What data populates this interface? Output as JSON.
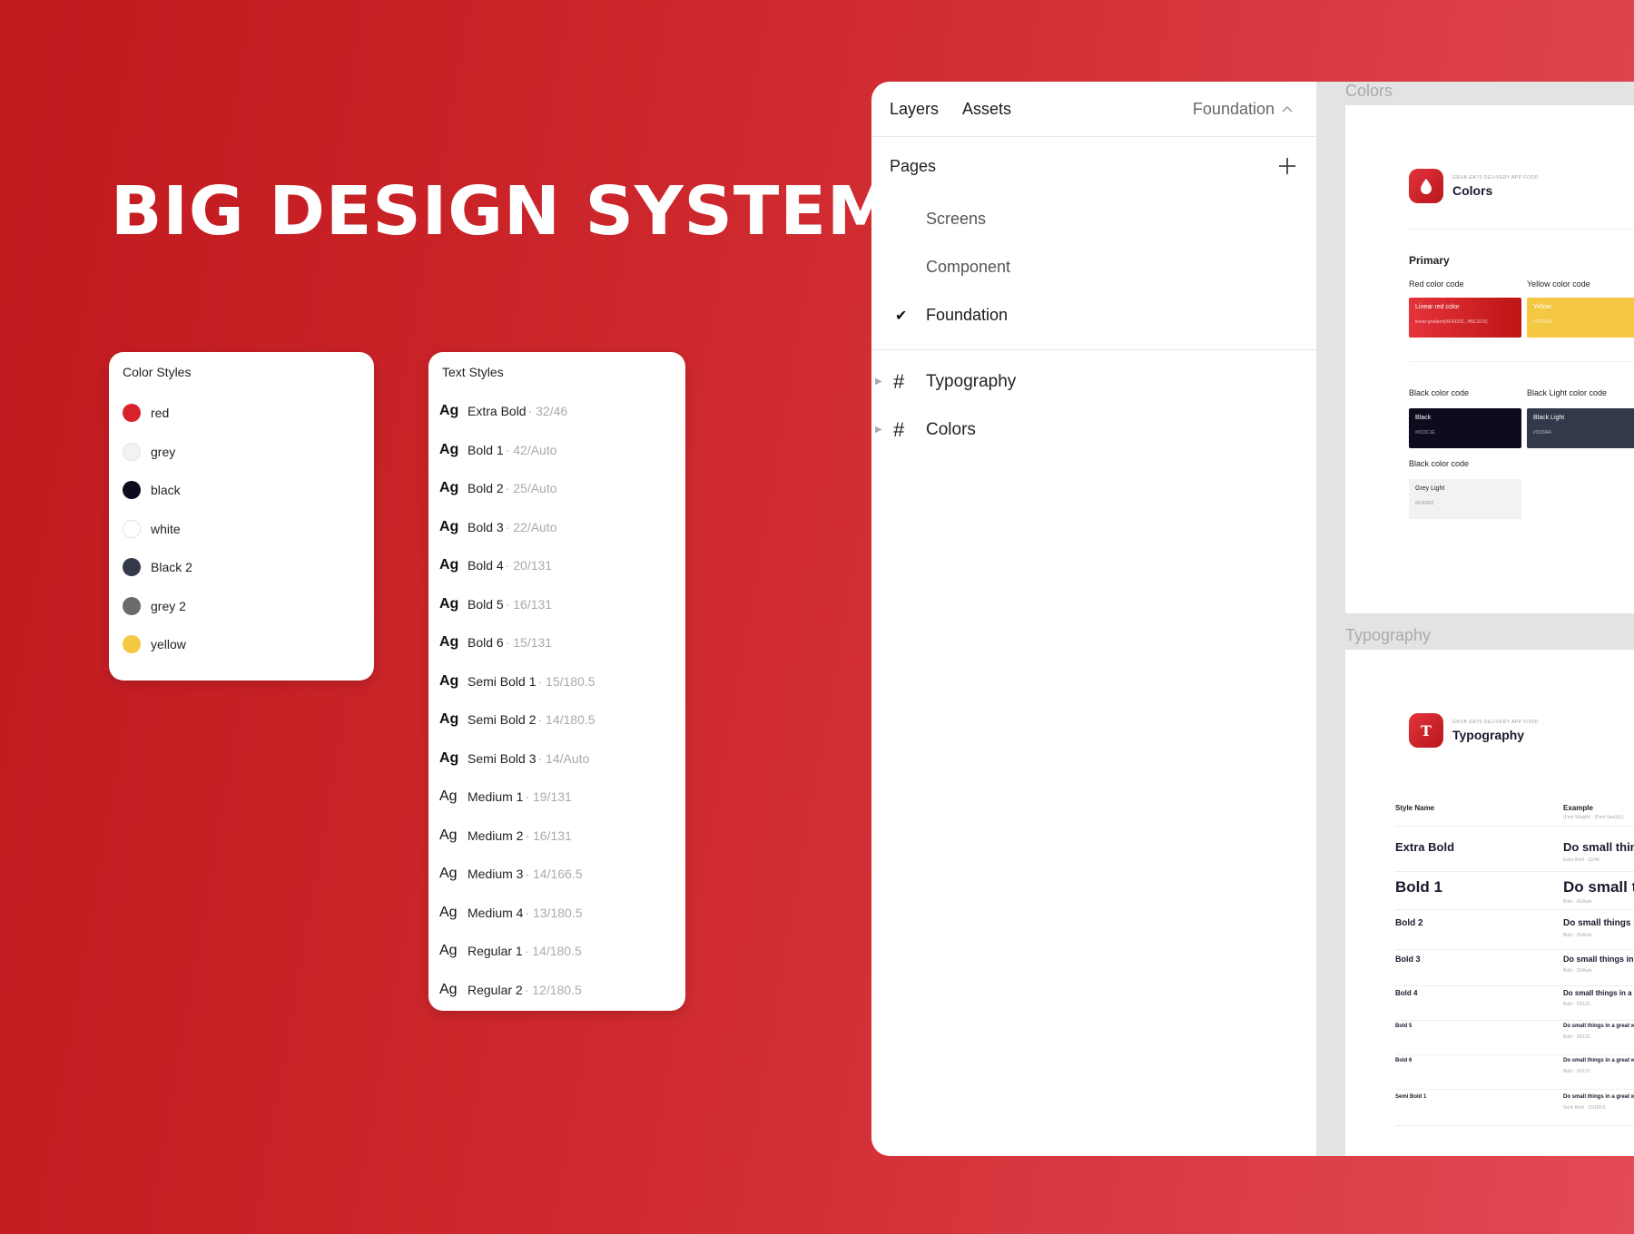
{
  "hero_title": "BIG DESIGN SYSTEM",
  "color_styles": {
    "title": "Color Styles",
    "items": [
      {
        "name": "red",
        "color": "#d8222b"
      },
      {
        "name": "grey",
        "color": "#f2f2f2"
      },
      {
        "name": "black",
        "color": "#0c0c1e"
      },
      {
        "name": "white",
        "color": "#ffffff"
      },
      {
        "name": "Black 2",
        "color": "#33394a"
      },
      {
        "name": "grey 2",
        "color": "#6b6b6b"
      },
      {
        "name": "yellow",
        "color": "#f4c842"
      }
    ]
  },
  "text_styles": {
    "title": "Text Styles",
    "glyph": "Ag",
    "items": [
      {
        "name": "Extra Bold",
        "spec": "· 32/46",
        "weight": 800
      },
      {
        "name": "Bold 1",
        "spec": "· 42/Auto",
        "weight": 700
      },
      {
        "name": "Bold 2",
        "spec": "· 25/Auto",
        "weight": 700
      },
      {
        "name": "Bold 3",
        "spec": "· 22/Auto",
        "weight": 700
      },
      {
        "name": "Bold 4",
        "spec": "· 20/131",
        "weight": 700
      },
      {
        "name": "Bold 5",
        "spec": "· 16/131",
        "weight": 700
      },
      {
        "name": "Bold 6",
        "spec": "· 15/131",
        "weight": 700
      },
      {
        "name": "Semi Bold 1",
        "spec": "· 15/180.5",
        "weight": 600
      },
      {
        "name": "Semi Bold 2",
        "spec": "· 14/180.5",
        "weight": 600
      },
      {
        "name": "Semi Bold 3",
        "spec": "· 14/Auto",
        "weight": 600
      },
      {
        "name": "Medium 1",
        "spec": "· 19/131",
        "weight": 500
      },
      {
        "name": "Medium 2",
        "spec": "· 16/131",
        "weight": 500
      },
      {
        "name": "Medium 3",
        "spec": "· 14/166.5",
        "weight": 500
      },
      {
        "name": "Medium 4",
        "spec": "· 13/180.5",
        "weight": 500
      },
      {
        "name": "Regular 1",
        "spec": "· 14/180.5",
        "weight": 400
      },
      {
        "name": "Regular 2",
        "spec": "· 12/180.5",
        "weight": 400
      }
    ]
  },
  "panel": {
    "tabs": [
      "Layers",
      "Assets"
    ],
    "current_page": "Foundation",
    "pages_label": "Pages",
    "add_icon": "plus-icon",
    "pages": [
      {
        "label": "Screens",
        "active": false
      },
      {
        "label": "Component",
        "active": false
      },
      {
        "label": "Foundation",
        "active": true
      }
    ],
    "frames": [
      "Typography",
      "Colors"
    ]
  },
  "canvas": {
    "colors_frame": {
      "label": "Colors",
      "brand_sub": "GRUB EATS DELIVERY APP FOOD",
      "brand_title": "Colors",
      "section": "Primary",
      "red_label": "Red color code",
      "yellow_label": "Yellow color code",
      "red_swatch_name": "Linear red color",
      "red_swatch_code": "linear-gradient(#E4333C, #BE1515)",
      "yellow_swatch_name": "Yellow",
      "yellow_swatch_code": "#F4C842",
      "black_label": "Black color code",
      "black_light_label": "Black Light color code",
      "black_swatch_name": "Black",
      "black_swatch_code": "#0C0C1E",
      "black_light_swatch_name": "Black Light",
      "black_light_swatch_code": "#33394A",
      "grey_label": "Black color code",
      "grey_swatch_name": "Grey Light",
      "grey_swatch_code": "#F2F2F2"
    },
    "typography_frame": {
      "label": "Typography",
      "brand_sub": "GRUB EATS DELIVERY APP FOOD",
      "brand_title": "Typography",
      "brand_glyph": "T",
      "col_name": "Style Name",
      "col_example": "Example",
      "col_example_sub": "(Font Weight) · (Font Size)/(L)",
      "rows": [
        {
          "name": "Extra Bold",
          "example": "Do small things",
          "meta": "Extra Bold · 32/46"
        },
        {
          "name": "Bold 1",
          "example": "Do small things",
          "meta": "Bold · 42/Auto"
        },
        {
          "name": "Bold 2",
          "example": "Do small things in a great way",
          "meta": "Bold · 25/Auto"
        },
        {
          "name": "Bold 3",
          "example": "Do small things in a great way",
          "meta": "Bold · 22/Auto"
        },
        {
          "name": "Bold 4",
          "example": "Do small things in a great way",
          "meta": "Bold · 20/131"
        },
        {
          "name": "Bold 5",
          "example": "Do small things in a great way",
          "meta": "Bold · 16/131"
        },
        {
          "name": "Bold 6",
          "example": "Do small things in a great way",
          "meta": "Bold · 15/131"
        },
        {
          "name": "Semi Bold 1",
          "example": "Do small things in a great way",
          "meta": "Semi Bold · 15/180.5"
        }
      ]
    }
  }
}
